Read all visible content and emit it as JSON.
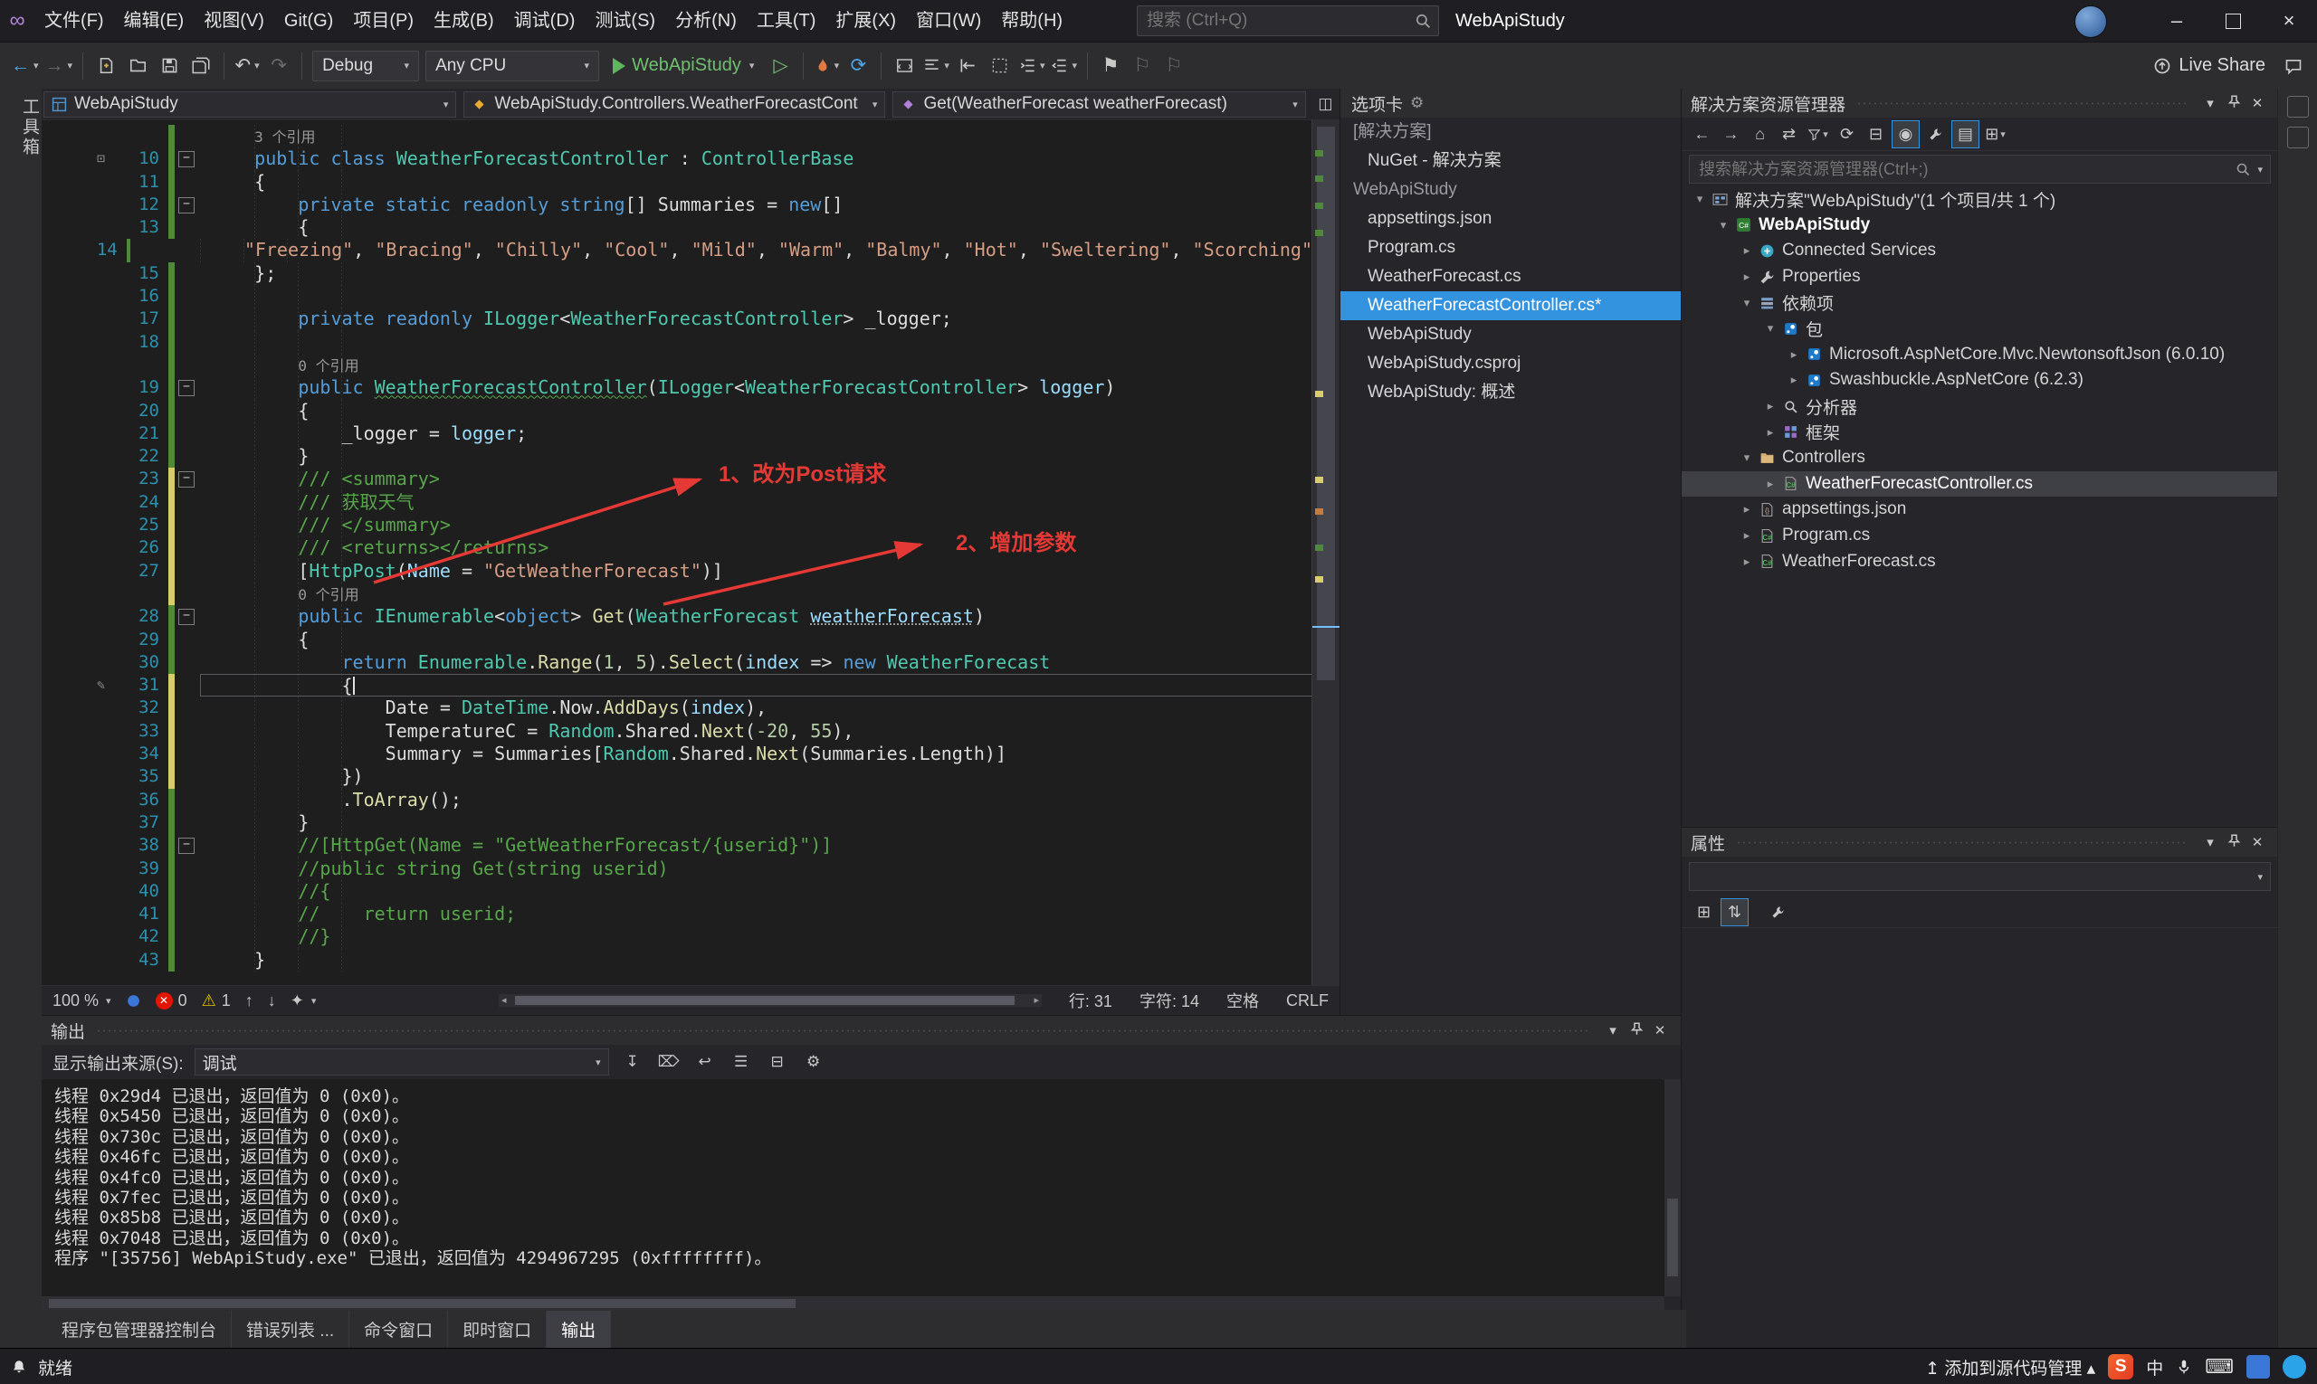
{
  "titlebar": {
    "menus": [
      "文件(F)",
      "编辑(E)",
      "视图(V)",
      "Git(G)",
      "项目(P)",
      "生成(B)",
      "调试(D)",
      "测试(S)",
      "分析(N)",
      "工具(T)",
      "扩展(X)",
      "窗口(W)",
      "帮助(H)"
    ],
    "search_placeholder": "搜索 (Ctrl+Q)",
    "window_title": "WebApiStudy"
  },
  "toolbar": {
    "config": "Debug",
    "platform": "Any CPU",
    "run_target": "WebApiStudy",
    "live_share": "Live Share"
  },
  "left_edge": {
    "toolbox_tab": "工具箱"
  },
  "editor": {
    "nav_project": "WebApiStudy",
    "nav_type": "WebApiStudy.Controllers.WeatherForecastCont",
    "nav_member": "Get(WeatherForecast weatherForecast)",
    "annotations": [
      {
        "label": "1、改为Post请求"
      },
      {
        "label": "2、增加参数"
      }
    ],
    "status": {
      "zoom": "100 %",
      "errors": "0",
      "warnings": "1",
      "line": "行: 31",
      "col": "字符: 14",
      "spaces": "空格",
      "eol": "CRLF"
    },
    "rows": [
      {
        "t": "lens",
        "mod": "g",
        "seg": [
          [
            "    ",
            "p"
          ],
          [
            "3 个引用",
            "lens"
          ]
        ]
      },
      {
        "t": "code",
        "n": "10",
        "mod": "g",
        "fold": true,
        "glyph": true,
        "seg": [
          [
            "    ",
            "p"
          ],
          [
            "public",
            "k"
          ],
          [
            " ",
            "p"
          ],
          [
            "class",
            "k"
          ],
          [
            " ",
            "p"
          ],
          [
            "WeatherForecastController",
            "t"
          ],
          [
            " : ",
            "p"
          ],
          [
            "ControllerBase",
            "t"
          ]
        ]
      },
      {
        "t": "code",
        "n": "11",
        "mod": "g",
        "seg": [
          [
            "    {",
            "p"
          ]
        ]
      },
      {
        "t": "code",
        "n": "12",
        "mod": "g",
        "fold": true,
        "seg": [
          [
            "        ",
            "p"
          ],
          [
            "private",
            "k"
          ],
          [
            " ",
            "p"
          ],
          [
            "static",
            "k"
          ],
          [
            " ",
            "p"
          ],
          [
            "readonly",
            "k"
          ],
          [
            " ",
            "p"
          ],
          [
            "string",
            "k"
          ],
          [
            "[] Summaries = ",
            "p"
          ],
          [
            "new",
            "k"
          ],
          [
            "[]",
            "p"
          ]
        ]
      },
      {
        "t": "code",
        "n": "13",
        "mod": "g",
        "seg": [
          [
            "        {",
            "p"
          ]
        ]
      },
      {
        "t": "code",
        "n": "14",
        "mod": "g",
        "seg": [
          [
            "        ",
            "p"
          ],
          [
            "\"Freezing\"",
            "s"
          ],
          [
            ", ",
            "p"
          ],
          [
            "\"Bracing\"",
            "s"
          ],
          [
            ", ",
            "p"
          ],
          [
            "\"Chilly\"",
            "s"
          ],
          [
            ", ",
            "p"
          ],
          [
            "\"Cool\"",
            "s"
          ],
          [
            ", ",
            "p"
          ],
          [
            "\"Mild\"",
            "s"
          ],
          [
            ", ",
            "p"
          ],
          [
            "\"Warm\"",
            "s"
          ],
          [
            ", ",
            "p"
          ],
          [
            "\"Balmy\"",
            "s"
          ],
          [
            ", ",
            "p"
          ],
          [
            "\"Hot\"",
            "s"
          ],
          [
            ", ",
            "p"
          ],
          [
            "\"Sweltering\"",
            "s"
          ],
          [
            ", ",
            "p"
          ],
          [
            "\"Scorching\"",
            "s"
          ]
        ]
      },
      {
        "t": "code",
        "n": "15",
        "mod": "g",
        "seg": [
          [
            "    };",
            "p"
          ]
        ]
      },
      {
        "t": "code",
        "n": "16",
        "mod": "g",
        "seg": []
      },
      {
        "t": "code",
        "n": "17",
        "mod": "g",
        "seg": [
          [
            "        ",
            "p"
          ],
          [
            "private",
            "k"
          ],
          [
            " ",
            "p"
          ],
          [
            "readonly",
            "k"
          ],
          [
            " ",
            "p"
          ],
          [
            "ILogger",
            "t"
          ],
          [
            "<",
            "p"
          ],
          [
            "WeatherForecastController",
            "t"
          ],
          [
            "> _logger;",
            "p"
          ]
        ]
      },
      {
        "t": "code",
        "n": "18",
        "mod": "g",
        "seg": []
      },
      {
        "t": "lens",
        "mod": "g",
        "seg": [
          [
            "        ",
            "p"
          ],
          [
            "0 个引用",
            "lens"
          ]
        ]
      },
      {
        "t": "code",
        "n": "19",
        "mod": "g",
        "fold": true,
        "seg": [
          [
            "        ",
            "p"
          ],
          [
            "public",
            "k"
          ],
          [
            " ",
            "p"
          ],
          [
            "WeatherForecastController",
            "t sqg"
          ],
          [
            "(",
            "p"
          ],
          [
            "ILogger",
            "t"
          ],
          [
            "<",
            "p"
          ],
          [
            "WeatherForecastController",
            "t"
          ],
          [
            "> ",
            "p"
          ],
          [
            "logger",
            "i"
          ],
          [
            ")",
            "p"
          ]
        ]
      },
      {
        "t": "code",
        "n": "20",
        "mod": "g",
        "seg": [
          [
            "        {",
            "p"
          ]
        ]
      },
      {
        "t": "code",
        "n": "21",
        "mod": "g",
        "seg": [
          [
            "            _logger = ",
            "p"
          ],
          [
            "logger",
            "i"
          ],
          [
            ";",
            "p"
          ]
        ]
      },
      {
        "t": "code",
        "n": "22",
        "mod": "g",
        "seg": [
          [
            "        }",
            "p"
          ]
        ]
      },
      {
        "t": "code",
        "n": "23",
        "mod": "y",
        "fold": true,
        "seg": [
          [
            "        ",
            "p"
          ],
          [
            "/// <summary>",
            "d"
          ]
        ]
      },
      {
        "t": "code",
        "n": "24",
        "mod": "y",
        "seg": [
          [
            "        ",
            "p"
          ],
          [
            "/// 获取天气",
            "d"
          ]
        ]
      },
      {
        "t": "code",
        "n": "25",
        "mod": "y",
        "seg": [
          [
            "        ",
            "p"
          ],
          [
            "/// </summary>",
            "d"
          ]
        ]
      },
      {
        "t": "code",
        "n": "26",
        "mod": "y",
        "seg": [
          [
            "        ",
            "p"
          ],
          [
            "/// <returns></returns>",
            "d"
          ]
        ]
      },
      {
        "t": "code",
        "n": "27",
        "mod": "y",
        "seg": [
          [
            "        [",
            "p"
          ],
          [
            "HttpPost",
            "t"
          ],
          [
            "(",
            "p"
          ],
          [
            "Name",
            "i"
          ],
          [
            " = ",
            "p"
          ],
          [
            "\"GetWeatherForecast\"",
            "s"
          ],
          [
            ")]",
            "p"
          ]
        ]
      },
      {
        "t": "lens",
        "mod": "y",
        "seg": [
          [
            "        ",
            "p"
          ],
          [
            "0 个引用",
            "lens"
          ]
        ]
      },
      {
        "t": "code",
        "n": "28",
        "mod": "g",
        "fold": true,
        "seg": [
          [
            "        ",
            "p"
          ],
          [
            "public",
            "k"
          ],
          [
            " ",
            "p"
          ],
          [
            "IEnumerable",
            "t"
          ],
          [
            "<",
            "p"
          ],
          [
            "object",
            "k"
          ],
          [
            "> ",
            "p"
          ],
          [
            "Get",
            "m"
          ],
          [
            "(",
            "p"
          ],
          [
            "WeatherForecast",
            "t"
          ],
          [
            " ",
            "p"
          ],
          [
            "weatherForecast",
            "i sqr"
          ],
          [
            ")",
            "p"
          ]
        ]
      },
      {
        "t": "code",
        "n": "29",
        "mod": "g",
        "seg": [
          [
            "        {",
            "p"
          ]
        ]
      },
      {
        "t": "code",
        "n": "30",
        "mod": "g",
        "seg": [
          [
            "            ",
            "p"
          ],
          [
            "return",
            "k"
          ],
          [
            " ",
            "p"
          ],
          [
            "Enumerable",
            "t"
          ],
          [
            ".",
            "p"
          ],
          [
            "Range",
            "m"
          ],
          [
            "(",
            "p"
          ],
          [
            "1",
            "n"
          ],
          [
            ", ",
            "p"
          ],
          [
            "5",
            "n"
          ],
          [
            ").",
            "p"
          ],
          [
            "Select",
            "m"
          ],
          [
            "(",
            "p"
          ],
          [
            "index",
            "i"
          ],
          [
            " => ",
            "p"
          ],
          [
            "new",
            "k"
          ],
          [
            " ",
            "p"
          ],
          [
            "WeatherForecast",
            "t"
          ]
        ]
      },
      {
        "t": "code",
        "n": "31",
        "mod": "y",
        "cur": true,
        "pen": true,
        "seg": [
          [
            "            {",
            "p"
          ],
          [
            "",
            "caret"
          ]
        ]
      },
      {
        "t": "code",
        "n": "32",
        "mod": "y",
        "seg": [
          [
            "                Date = ",
            "p"
          ],
          [
            "DateTime",
            "t"
          ],
          [
            ".Now.",
            "p"
          ],
          [
            "AddDays",
            "m"
          ],
          [
            "(",
            "p"
          ],
          [
            "index",
            "i"
          ],
          [
            "),",
            "p"
          ]
        ]
      },
      {
        "t": "code",
        "n": "33",
        "mod": "y",
        "seg": [
          [
            "                TemperatureC = ",
            "p"
          ],
          [
            "Random",
            "t"
          ],
          [
            ".Shared.",
            "p"
          ],
          [
            "Next",
            "m"
          ],
          [
            "(",
            "p"
          ],
          [
            "-20",
            "n"
          ],
          [
            ", ",
            "p"
          ],
          [
            "55",
            "n"
          ],
          [
            "),",
            "p"
          ]
        ]
      },
      {
        "t": "code",
        "n": "34",
        "mod": "y",
        "seg": [
          [
            "                Summary = Summaries[",
            "p"
          ],
          [
            "Random",
            "t"
          ],
          [
            ".Shared.",
            "p"
          ],
          [
            "Next",
            "m"
          ],
          [
            "(Summaries.Length)]",
            "p"
          ]
        ]
      },
      {
        "t": "code",
        "n": "35",
        "mod": "y",
        "seg": [
          [
            "            })",
            "p"
          ]
        ]
      },
      {
        "t": "code",
        "n": "36",
        "mod": "g",
        "seg": [
          [
            "            .",
            "p"
          ],
          [
            "ToArray",
            "m"
          ],
          [
            "();",
            "p"
          ]
        ]
      },
      {
        "t": "code",
        "n": "37",
        "mod": "g",
        "seg": [
          [
            "        }",
            "p"
          ]
        ]
      },
      {
        "t": "code",
        "n": "38",
        "mod": "g",
        "fold": true,
        "seg": [
          [
            "        ",
            "p"
          ],
          [
            "//[HttpGet(Name = \"GetWeatherForecast/{userid}\")]",
            "c"
          ]
        ]
      },
      {
        "t": "code",
        "n": "39",
        "mod": "g",
        "seg": [
          [
            "        ",
            "p"
          ],
          [
            "//public string Get(string userid)",
            "c"
          ]
        ]
      },
      {
        "t": "code",
        "n": "40",
        "mod": "g",
        "seg": [
          [
            "        ",
            "p"
          ],
          [
            "//{",
            "c"
          ]
        ]
      },
      {
        "t": "code",
        "n": "41",
        "mod": "g",
        "seg": [
          [
            "        ",
            "p"
          ],
          [
            "//    return userid;",
            "c"
          ]
        ]
      },
      {
        "t": "code",
        "n": "42",
        "mod": "g",
        "seg": [
          [
            "        ",
            "p"
          ],
          [
            "//}",
            "c"
          ]
        ]
      },
      {
        "t": "code",
        "n": "43",
        "mod": "g",
        "seg": [
          [
            "    }",
            "p"
          ]
        ]
      }
    ]
  },
  "tabs_panel": {
    "title": "选项卡",
    "groups": [
      {
        "header": "[解决方案]",
        "items": [
          {
            "label": "NuGet - 解决方案"
          }
        ]
      },
      {
        "header": "WebApiStudy",
        "items": [
          {
            "label": "appsettings.json"
          },
          {
            "label": "Program.cs"
          },
          {
            "label": "WeatherForecast.cs"
          },
          {
            "label": "WeatherForecastController.cs*",
            "active": true
          },
          {
            "label": "WebApiStudy"
          },
          {
            "label": "WebApiStudy.csproj"
          },
          {
            "label": "WebApiStudy: 概述"
          }
        ]
      }
    ]
  },
  "solution_explorer": {
    "title": "解决方案资源管理器",
    "search_placeholder": "搜索解决方案资源管理器(Ctrl+;)",
    "tree": [
      {
        "label": "解决方案\"WebApiStudy\"(1 个项目/共 1 个)",
        "icon": "solution-icon",
        "depth": 0,
        "expand": "down"
      },
      {
        "label": "WebApiStudy",
        "icon": "csproj-icon",
        "depth": 1,
        "expand": "down",
        "bold": true
      },
      {
        "label": "Connected Services",
        "icon": "connected-services-icon",
        "depth": 2,
        "expand": "right"
      },
      {
        "label": "Properties",
        "icon": "properties-icon",
        "depth": 2,
        "expand": "right"
      },
      {
        "label": "依赖项",
        "icon": "dependencies-icon",
        "depth": 2,
        "expand": "down"
      },
      {
        "label": "包",
        "icon": "package-icon",
        "depth": 3,
        "expand": "down"
      },
      {
        "label": "Microsoft.AspNetCore.Mvc.NewtonsoftJson (6.0.10)",
        "icon": "nuget-package-icon",
        "depth": 4,
        "expand": "right"
      },
      {
        "label": "Swashbuckle.AspNetCore (6.2.3)",
        "icon": "nuget-package-icon",
        "depth": 4,
        "expand": "right"
      },
      {
        "label": "分析器",
        "icon": "analyzers-icon",
        "depth": 3,
        "expand": "right"
      },
      {
        "label": "框架",
        "icon": "framework-icon",
        "depth": 3,
        "expand": "right"
      },
      {
        "label": "Controllers",
        "icon": "folder-icon",
        "depth": 2,
        "expand": "down"
      },
      {
        "label": "WeatherForecastController.cs",
        "icon": "csharp-file-icon",
        "depth": 3,
        "expand": "right",
        "selected": true
      },
      {
        "label": "appsettings.json",
        "icon": "json-file-icon",
        "depth": 2,
        "expand": "right"
      },
      {
        "label": "Program.cs",
        "icon": "csharp-file-icon",
        "depth": 2,
        "expand": "right"
      },
      {
        "label": "WeatherForecast.cs",
        "icon": "csharp-file-icon",
        "depth": 2,
        "expand": "right"
      }
    ]
  },
  "properties_panel": {
    "title": "属性"
  },
  "output_panel": {
    "title": "输出",
    "source_label": "显示输出来源(S):",
    "source_value": "调试",
    "lines": [
      "线程 0x29d4 已退出，返回值为 0 (0x0)。",
      "线程 0x5450 已退出，返回值为 0 (0x0)。",
      "线程 0x730c 已退出，返回值为 0 (0x0)。",
      "线程 0x46fc 已退出，返回值为 0 (0x0)。",
      "线程 0x4fc0 已退出，返回值为 0 (0x0)。",
      "线程 0x7fec 已退出，返回值为 0 (0x0)。",
      "线程 0x85b8 已退出，返回值为 0 (0x0)。",
      "线程 0x7048 已退出，返回值为 0 (0x0)。",
      "程序 \"[35756] WebApiStudy.exe\" 已退出，返回值为 4294967295 (0xffffffff)。"
    ]
  },
  "bottom_tabs": [
    {
      "label": "程序包管理器控制台"
    },
    {
      "label": "错误列表 ..."
    },
    {
      "label": "命令窗口"
    },
    {
      "label": "即时窗口"
    },
    {
      "label": "输出",
      "active": true
    }
  ],
  "statusbar": {
    "ready": "就绪",
    "source_control": "添加到源代码管理",
    "ime": "中"
  }
}
